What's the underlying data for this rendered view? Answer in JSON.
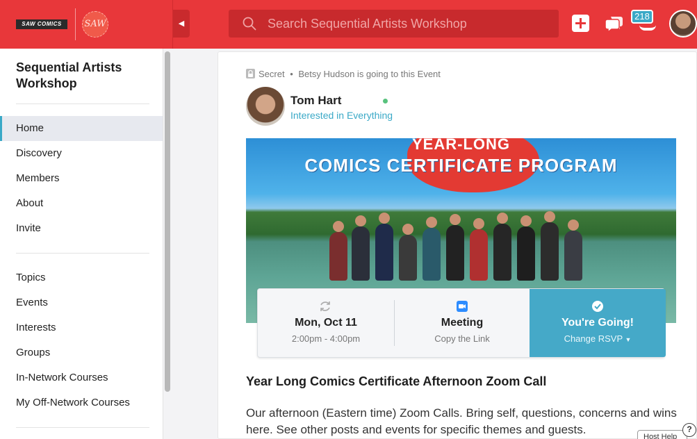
{
  "header": {
    "logo_text": "SAW COMICS",
    "seal_text": "SAW",
    "search_placeholder": "Search Sequential Artists Workshop",
    "notification_count": "218",
    "colors": {
      "brand_red": "#e8373a",
      "accent_teal": "#3aa9c7"
    }
  },
  "sidebar": {
    "network_title": "Sequential Artists Workshop",
    "primary": [
      {
        "label": "Home",
        "active": true
      },
      {
        "label": "Discovery"
      },
      {
        "label": "Members"
      },
      {
        "label": "About"
      },
      {
        "label": "Invite"
      }
    ],
    "secondary": [
      {
        "label": "Topics"
      },
      {
        "label": "Events"
      },
      {
        "label": "Interests"
      },
      {
        "label": "Groups"
      },
      {
        "label": "In-Network Courses"
      },
      {
        "label": "My Off-Network Courses"
      }
    ]
  },
  "post": {
    "privacy": "Secret",
    "attendee_note": "Betsy Hudson is going to this Event",
    "separator": "•",
    "author_name": "Tom Hart",
    "author_subtitle": "Interested in Everything",
    "banner_line1": "YEAR-LONG",
    "banner_line2": "COMICS CERTIFICATE PROGRAM",
    "date": "Mon, Oct 11",
    "time": "2:00pm - 4:00pm",
    "meeting_label": "Meeting",
    "meeting_sub": "Copy the Link",
    "rsvp_label": "You're Going!",
    "rsvp_sub": "Change RSVP",
    "event_title": "Year Long Comics Certificate Afternoon Zoom Call",
    "event_description": "Our afternoon (Eastern time) Zoom Calls. Bring self, questions, concerns and wins here. See other posts and events for specific themes and guests."
  },
  "help": {
    "host_help": "Host Help",
    "help_glyph": "?"
  }
}
